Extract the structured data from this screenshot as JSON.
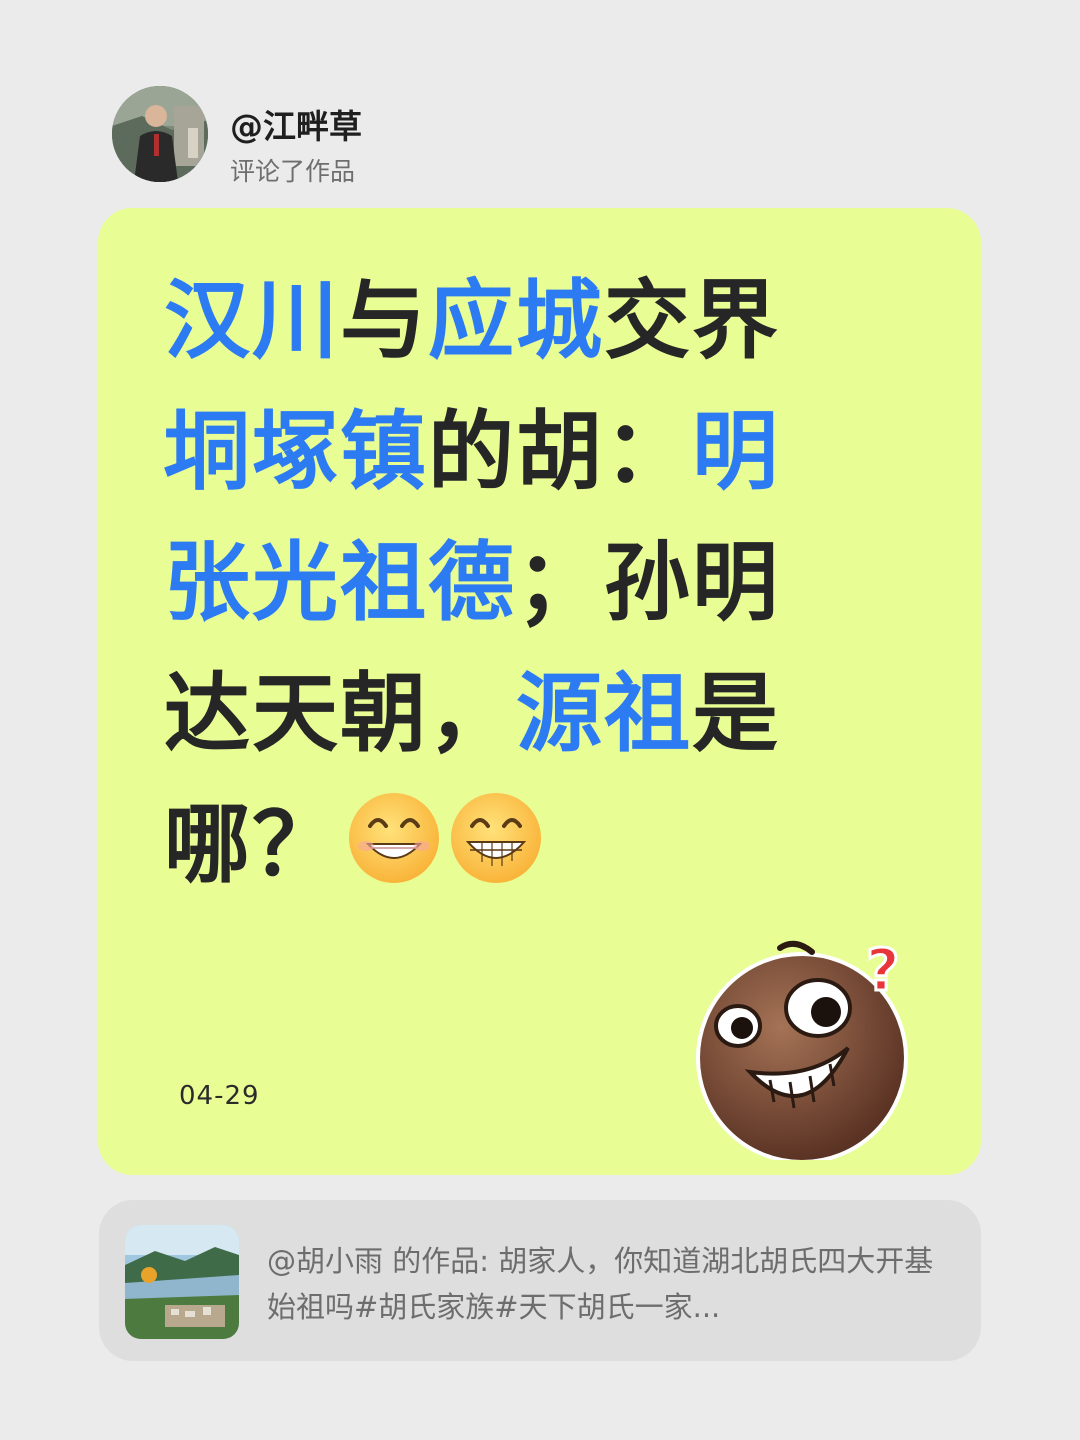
{
  "header": {
    "user_name": "@江畔草",
    "action": "评论了作品",
    "avatar_icon": "user-avatar-photo"
  },
  "comment": {
    "segments": [
      {
        "text": "汉川",
        "highlight": true
      },
      {
        "text": "与",
        "highlight": false
      },
      {
        "text": "应城",
        "highlight": true
      },
      {
        "text": "交界",
        "highlight": false
      },
      {
        "text": "垌塚镇",
        "highlight": true
      },
      {
        "text": "的胡：",
        "highlight": false
      },
      {
        "text": "明张光祖德",
        "highlight": true
      },
      {
        "text": "；孙明达天朝，",
        "highlight": false
      },
      {
        "text": "源祖",
        "highlight": true
      },
      {
        "text": "是哪？",
        "highlight": false
      }
    ],
    "emojis": [
      "grin-emoji",
      "grin-emoji"
    ],
    "date": "04-29",
    "sticker": "confused-grin-sticker-icon"
  },
  "reference": {
    "text": "@胡小雨  的作品: 胡家人，你知道湖北胡氏四大开基始祖吗#胡氏家族#天下胡氏一家...",
    "thumb": "mountain-village-thumbnail"
  },
  "colors": {
    "background": "#ebebeb",
    "card": "#e9fd95",
    "highlight": "#2d7bf2",
    "text": "#262626",
    "reference_bg": "#dedede"
  }
}
